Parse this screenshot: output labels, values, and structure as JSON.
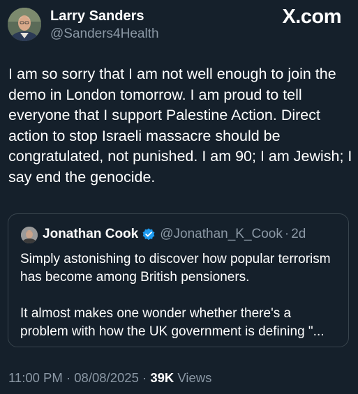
{
  "author": {
    "name": "Larry Sanders",
    "handle": "@Sanders4Health"
  },
  "source_logo": "X.com",
  "tweet": {
    "text": "I am so sorry that I am not well enough to join the demo in London tomorrow. I am proud to tell everyone that I support Palestine Action. Direct action to stop Israeli massacre should be congratulated, not punished. I am 90; I am Jewish; I say end the genocide."
  },
  "quoted_tweet": {
    "name": "Jonathan Cook",
    "handle": "@Jonathan_K_Cook",
    "separator": "·",
    "age": "2d",
    "paragraph_1": "Simply astonishing to discover how popular terrorism has become among British pensioners.",
    "paragraph_2": "It almost makes one wonder whether there's a problem with how the UK government is defining \"..."
  },
  "meta": {
    "time": "11:00 PM",
    "separator": "·",
    "date": "08/08/2025",
    "views_count": "39K",
    "views_label": "Views"
  },
  "colors": {
    "background": "#15202b",
    "primary_text": "#ffffff",
    "secondary_text": "#8b98a5",
    "border": "#38444d",
    "verified_badge": "#1d9bf0"
  },
  "icons": {
    "verified": "verified-badge-icon"
  }
}
